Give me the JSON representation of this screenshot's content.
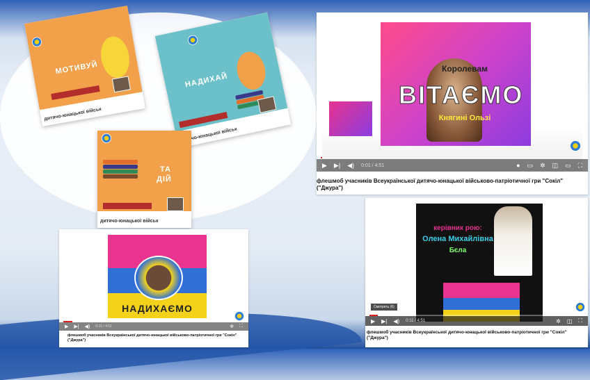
{
  "cards": [
    {
      "word": "МОТИВУЙ",
      "caption": "дитячо-юнацької військ"
    },
    {
      "word": "НАДИХАЙ",
      "caption": "дитячо-юнацької військ"
    },
    {
      "word_line1": "ТА",
      "word_line2": "ДІЙ",
      "caption": "дитячо-юнацької військ"
    }
  ],
  "player_main": {
    "title_big": "ВІТАЄМО",
    "title_top": "Королевам",
    "title_bottom": "Княгині Ользі",
    "time": "0:01 / 4:51",
    "progress": 0.004,
    "caption": "флешмоб учасників Всеукраїнської дитячо-юнацької військово-патріотичної гри \"Сокіл\" (\"Джура\")"
  },
  "player_bottom_left": {
    "title_big": "НАДИХАЄМО",
    "time": "0:15 / 4:51",
    "progress": 0.05,
    "caption": "флешмоб учасників Всеукраїнської дитячо-юнацької військово-патріотичної гри \"Сокіл\" (\"Джура\")"
  },
  "player_bottom_right": {
    "line1": "керівник рою:",
    "line2": "Олена Михайлівна",
    "line3": "Бєла",
    "watch_label": "Смотреть (6)",
    "time": "0:11 / 4:51",
    "progress": 0.04,
    "caption": "флешмоб учасників Всеукраїнської дитячо-юнацької військово-патріотичної гри \"Сокіл\" (\"Джура\")"
  },
  "icons": {
    "play": "play-icon",
    "next": "next-icon",
    "volume": "volume-icon",
    "settings": "settings-icon",
    "fullscreen": "fullscreen-icon"
  },
  "colors": {
    "progress": "#e02020",
    "orange": "#f2a04a",
    "teal": "#6cc0c9",
    "pink": "#e8338f",
    "blue_flag": "#2f6fd6",
    "yellow_flag": "#f4d21a"
  }
}
